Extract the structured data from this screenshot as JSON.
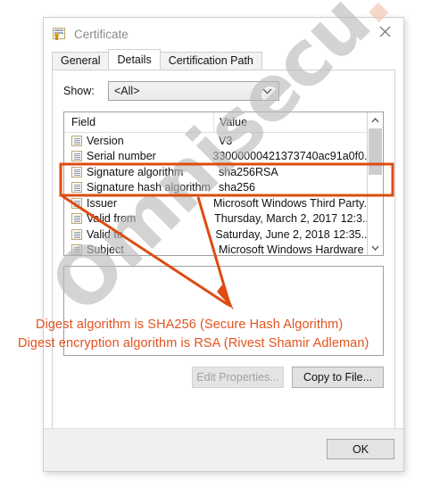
{
  "window": {
    "title": "Certificate",
    "icon": "certificate-icon",
    "close_label": "✕"
  },
  "tabs": [
    {
      "label": "General",
      "active": false
    },
    {
      "label": "Details",
      "active": true
    },
    {
      "label": "Certification Path",
      "active": false
    }
  ],
  "show": {
    "label": "Show:",
    "value": "<All>",
    "chevron": "chevron-down-icon"
  },
  "table": {
    "columns": [
      "Field",
      "Value"
    ],
    "rows": [
      {
        "field": "Version",
        "value": "V3",
        "highlighted": false
      },
      {
        "field": "Serial number",
        "value": "33000000421373740ac91a0f0...",
        "highlighted": false
      },
      {
        "field": "Signature algorithm",
        "value": "sha256RSA",
        "highlighted": true
      },
      {
        "field": "Signature hash algorithm",
        "value": "sha256",
        "highlighted": true
      },
      {
        "field": "Issuer",
        "value": "Microsoft Windows Third Party...",
        "highlighted": false
      },
      {
        "field": "Valid from",
        "value": "Thursday, March 2, 2017 12:3...",
        "highlighted": false
      },
      {
        "field": "Valid to",
        "value": "Saturday, June 2, 2018 12:35...",
        "highlighted": false
      },
      {
        "field": "Subject",
        "value": "Microsoft Windows Hardware",
        "highlighted": false
      }
    ]
  },
  "detail_pane": {
    "text": ""
  },
  "buttons": {
    "edit_properties": "Edit Properties...",
    "copy_to_file": "Copy to File...",
    "ok": "OK"
  },
  "annotations": {
    "line1": "Digest algorithm is SHA256 (Secure Hash Algorithm)",
    "line2": "Digest encryption algorithm is RSA (Rivest Shamir Adleman)",
    "color": "#e2531f",
    "highlight_box_color": "#dd4c12"
  },
  "watermark": {
    "text_grey": "Omnisecu",
    "text_pink": ".com",
    "grey_color": "#b9b9b9",
    "pink_color": "#f3c0a8"
  }
}
